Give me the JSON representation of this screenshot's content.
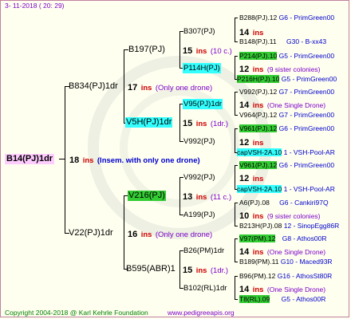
{
  "header": {
    "date": "3- 11-2018 ( 20: 29)"
  },
  "footer": {
    "copyright": "Copyright 2004-2018 @ Karl Kehrle Foundation",
    "website": "www.pedigreeapis.org"
  },
  "root": {
    "id": "B14(PJ)1dr",
    "ins_num": "18",
    "ins_label": "ins",
    "note": "(Insem. with only one drone)"
  },
  "gen1": [
    {
      "id": "B834(PJ)1dr",
      "ins_num": "17",
      "ins_label": "ins",
      "note": "(Only one drone)"
    },
    {
      "id": "V22(PJ)1dr",
      "ins_num": "16",
      "ins_label": "ins",
      "note": "(Only one drone)"
    }
  ],
  "gen2": [
    {
      "id": "B197(PJ)",
      "ins_num": "15",
      "ins_label": "ins",
      "note": "(10 c.)"
    },
    {
      "id": "V5H(PJ)1dr",
      "ins_num": "15",
      "ins_label": "ins",
      "note": "(1dr.)"
    },
    {
      "id": "V216(PJ)",
      "ins_num": "13",
      "ins_label": "ins",
      "note": "(11 c.)"
    },
    {
      "id": "B595(ABR)1",
      "ins_num": "15",
      "ins_label": "ins",
      "note": "(1dr.)"
    }
  ],
  "gen3": [
    {
      "id": "B307(PJ)",
      "ins_num": "14",
      "ins_label": "ins",
      "note": ""
    },
    {
      "id": "P114H(PJ)",
      "ins_num": "12",
      "ins_label": "ins",
      "note": "(9 sister colonies)"
    },
    {
      "id": "V95(PJ)1dr",
      "ins_num": "14",
      "ins_label": "ins",
      "note": "(One Single Drone)"
    },
    {
      "id": "V992(PJ)",
      "ins_num": "12",
      "ins_label": "ins",
      "note": ""
    },
    {
      "id": "V992(PJ)",
      "ins_num": "12",
      "ins_label": "ins",
      "note": ""
    },
    {
      "id": "A199(PJ)",
      "ins_num": "10",
      "ins_label": "ins",
      "note": "(9 sister colonies)"
    },
    {
      "id": "B26(PM)1dr",
      "ins_num": "14",
      "ins_label": "ins",
      "note": "(One Single Drone)"
    },
    {
      "id": "B102(RL)1dr",
      "ins_num": "14",
      "ins_label": "ins",
      "note": "(One Single Drone)"
    }
  ],
  "gen4": [
    {
      "id": "B288(PJ).12",
      "info": "G6 - PrimGreen00"
    },
    {
      "id": "B148(PJ).11",
      "info": "G30 - B-xx43"
    },
    {
      "id": "P214(PJ).10",
      "info": "G5 - PrimGreen00"
    },
    {
      "id": "P216H(PJ).10",
      "info": "G5 - PrimGreen00"
    },
    {
      "id": "V992(PJ).12",
      "info": "G7 - PrimGreen00"
    },
    {
      "id": "V964(PJ).12",
      "info": "G7 - PrimGreen00"
    },
    {
      "id": "V961(PJ).12",
      "info": "G6 - PrimGreen00"
    },
    {
      "id": "capVSH-2A.10",
      "info": "1 - VSH-Pool-AR"
    },
    {
      "id": "V961(PJ).12",
      "info": "G6 - PrimGreen00"
    },
    {
      "id": "capVSH-2A.10",
      "info": "1 - VSH-Pool-AR"
    },
    {
      "id": "A6(PJ).08",
      "info": "G6 - Cankiri97Q"
    },
    {
      "id": "B213H(PJ).08",
      "info": "12 - SinopEgg86R"
    },
    {
      "id": "V97(PM).12",
      "info": "G8 - Athos00R"
    },
    {
      "id": "B189(PM).11",
      "info": "G10 - Maced93R"
    },
    {
      "id": "B96(PM).12",
      "info": "G16 - AthosSt80R"
    },
    {
      "id": "T8(RL).09",
      "info": "G5 - Athos00R"
    }
  ]
}
